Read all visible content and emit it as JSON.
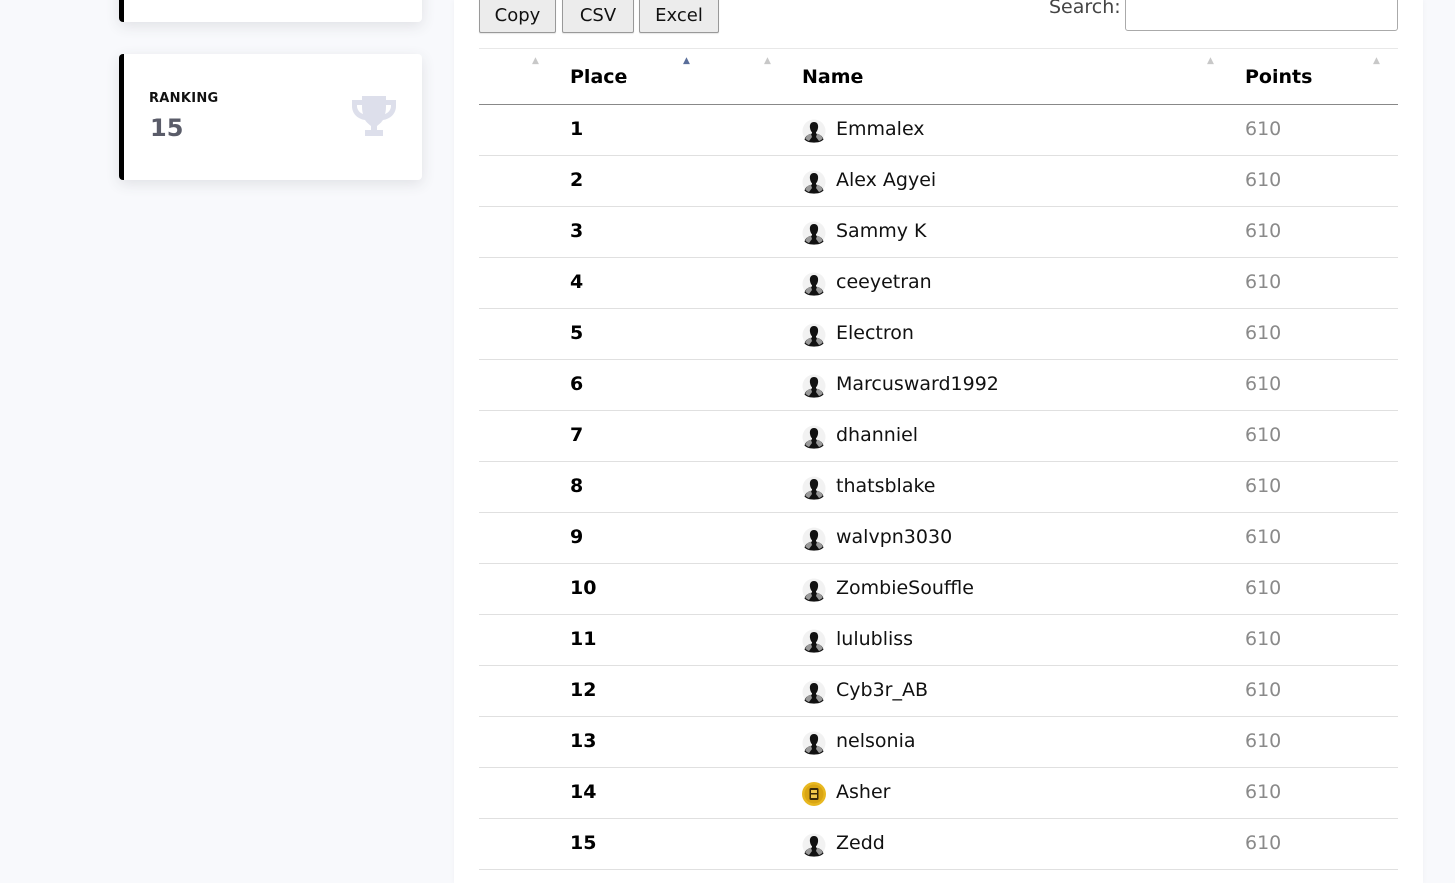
{
  "sidebar": {
    "ranking_card": {
      "label": "RANKING",
      "value": "15",
      "icon": "trophy-icon"
    }
  },
  "toolbar": {
    "buttons": [
      "Copy",
      "CSV",
      "Excel"
    ],
    "search_label": "Search:",
    "search_value": ""
  },
  "table": {
    "headers": {
      "place": "Place",
      "name": "Name",
      "points": "Points"
    },
    "sorted_column": "place",
    "rows": [
      {
        "place": "1",
        "name": "Emmalex",
        "points": "610",
        "avatar": "default-user-avatar"
      },
      {
        "place": "2",
        "name": "Alex Agyei",
        "points": "610",
        "avatar": "default-user-avatar"
      },
      {
        "place": "3",
        "name": "Sammy K",
        "points": "610",
        "avatar": "default-user-avatar"
      },
      {
        "place": "4",
        "name": "ceeyetran",
        "points": "610",
        "avatar": "default-user-avatar"
      },
      {
        "place": "5",
        "name": "Electron",
        "points": "610",
        "avatar": "default-user-avatar"
      },
      {
        "place": "6",
        "name": "Marcusward1992",
        "points": "610",
        "avatar": "default-user-avatar"
      },
      {
        "place": "7",
        "name": "dhanniel",
        "points": "610",
        "avatar": "default-user-avatar"
      },
      {
        "place": "8",
        "name": "thatsblake",
        "points": "610",
        "avatar": "default-user-avatar"
      },
      {
        "place": "9",
        "name": "walvpn3030",
        "points": "610",
        "avatar": "default-user-avatar"
      },
      {
        "place": "10",
        "name": "ZombieSouffle",
        "points": "610",
        "avatar": "default-user-avatar"
      },
      {
        "place": "11",
        "name": "lulubliss",
        "points": "610",
        "avatar": "default-user-avatar"
      },
      {
        "place": "12",
        "name": "Cyb3r_AB",
        "points": "610",
        "avatar": "default-user-avatar"
      },
      {
        "place": "13",
        "name": "nelsonia",
        "points": "610",
        "avatar": "default-user-avatar"
      },
      {
        "place": "14",
        "name": "Asher",
        "points": "610",
        "avatar": "custom-user-avatar"
      },
      {
        "place": "15",
        "name": "Zedd",
        "points": "610",
        "avatar": "default-user-avatar"
      }
    ]
  },
  "colors": {
    "page_bg": "#f8f9fc",
    "card_accent": "#000000",
    "stat_value": "#5a5c69",
    "trophy": "#dddfeb",
    "points_text": "#8a8a8a",
    "custom_avatar": "#e8b820"
  }
}
